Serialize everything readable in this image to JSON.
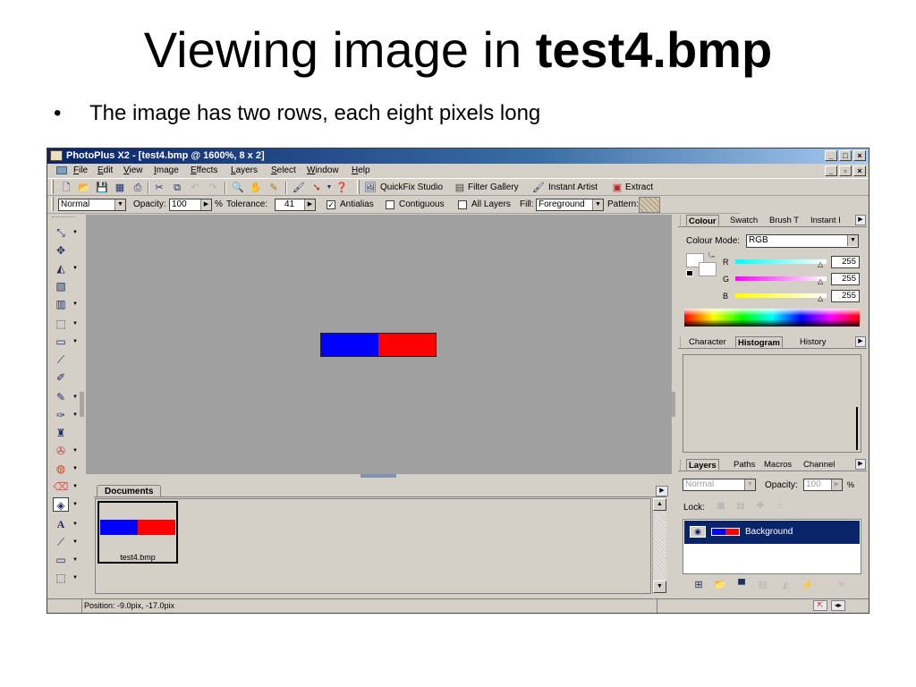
{
  "slide": {
    "title_plain": "Viewing image in ",
    "title_bold": "test4.bmp",
    "bullet": "The image has two rows, each eight pixels long"
  },
  "window": {
    "title": "PhotoPlus X2 - [test4.bmp @ 1600%, 8 x 2]",
    "min": "_",
    "max": "□",
    "close": "×",
    "mdi_min": "_",
    "mdi_restore": "▫",
    "mdi_close": "×"
  },
  "menu": [
    "File",
    "Edit",
    "View",
    "Image",
    "Effects",
    "Layers",
    "Select",
    "Window",
    "Help"
  ],
  "toolbar": {
    "quickfix": "QuickFix Studio",
    "filter_gallery": "Filter Gallery",
    "instant_artist": "Instant Artist",
    "extract": "Extract"
  },
  "context": {
    "blend_mode": "Normal",
    "opacity_label": "Opacity:",
    "opacity_value": "100",
    "pct": "%",
    "tolerance_label": "Tolerance:",
    "tolerance_value": "41",
    "antialias_label": "Antialias",
    "contiguous_label": "Contiguous",
    "all_layers_label": "All Layers",
    "fill_label": "Fill:",
    "fill_value": "Foreground",
    "pattern_label": "Pattern:",
    "antialias_checked": "✓"
  },
  "documents": {
    "tab": "Documents",
    "thumb_caption": "test4.bmp"
  },
  "status": {
    "position": "Position: -9.0pix, -17.0pix"
  },
  "colour_panel": {
    "tabs": [
      "Colour",
      "Swatch",
      "Brush T",
      "Instant I"
    ],
    "mode_label": "Colour Mode:",
    "mode_value": "RGB",
    "channels": [
      {
        "label": "R",
        "value": "255",
        "color": "#00ffff"
      },
      {
        "label": "G",
        "value": "255",
        "color": "#ff00ff"
      },
      {
        "label": "B",
        "value": "255",
        "color": "#ffff00"
      }
    ]
  },
  "histogram_panel": {
    "tabs": [
      "Character",
      "Histogram",
      "History"
    ]
  },
  "layers_panel": {
    "tabs": [
      "Layers",
      "Paths",
      "Macros",
      "Channel"
    ],
    "blend_mode": "Normal",
    "opacity_label": "Opacity:",
    "opacity_value": "100",
    "pct": "%",
    "lock_label": "Lock:",
    "layer_name": "Background"
  },
  "colors": {
    "image_left": "#0000ff",
    "image_right": "#ff0000",
    "canvas_bg": "#a0a0a0",
    "selection": "#0a246a"
  }
}
